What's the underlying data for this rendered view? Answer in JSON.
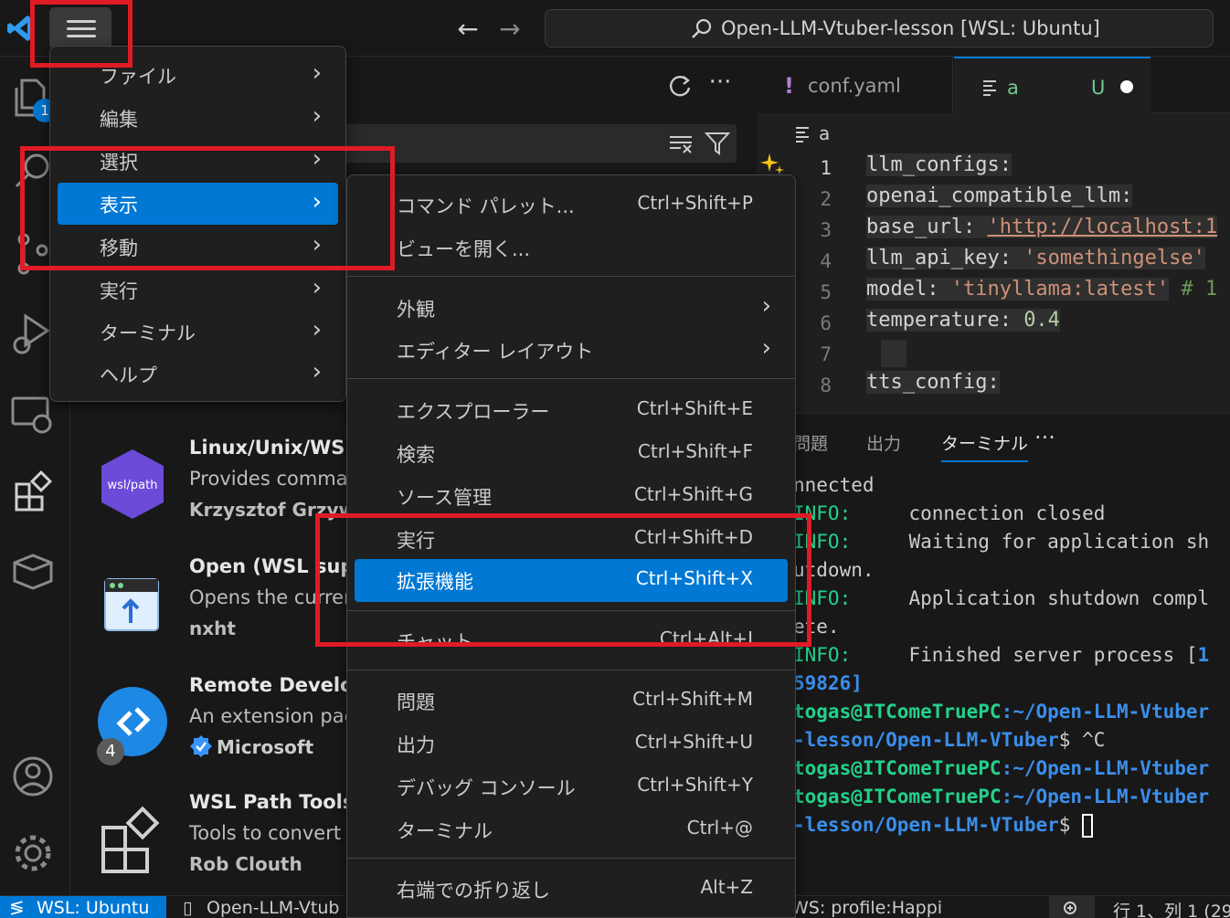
{
  "window": {
    "title": "Open-LLM-Vtuber-lesson [WSL: Ubuntu]"
  },
  "menubar": {
    "items": [
      {
        "label": "ファイル"
      },
      {
        "label": "編集"
      },
      {
        "label": "選択"
      },
      {
        "label": "表示"
      },
      {
        "label": "移動"
      },
      {
        "label": "実行"
      },
      {
        "label": "ターミナル"
      },
      {
        "label": "ヘルプ"
      }
    ],
    "selected": "表示"
  },
  "view_menu": {
    "items": [
      {
        "label": "コマンド パレット...",
        "shortcut": "Ctrl+Shift+P"
      },
      {
        "label": "ビューを開く...",
        "shortcut": ""
      },
      {
        "label": "外観",
        "shortcut": ""
      },
      {
        "label": "エディター レイアウト",
        "shortcut": ""
      },
      {
        "label": "エクスプローラー",
        "shortcut": "Ctrl+Shift+E"
      },
      {
        "label": "検索",
        "shortcut": "Ctrl+Shift+F"
      },
      {
        "label": "ソース管理",
        "shortcut": "Ctrl+Shift+G"
      },
      {
        "label": "実行",
        "shortcut": "Ctrl+Shift+D"
      },
      {
        "label": "拡張機能",
        "shortcut": "Ctrl+Shift+X"
      },
      {
        "label": "チャット",
        "shortcut": "Ctrl+Alt+I"
      },
      {
        "label": "問題",
        "shortcut": "Ctrl+Shift+M"
      },
      {
        "label": "出力",
        "shortcut": "Ctrl+Shift+U"
      },
      {
        "label": "デバッグ コンソール",
        "shortcut": "Ctrl+Shift+Y"
      },
      {
        "label": "ターミナル",
        "shortcut": "Ctrl+@"
      },
      {
        "label": "右端での折り返し",
        "shortcut": "Alt+Z"
      }
    ],
    "selected": "拡張機能"
  },
  "activity_bar": {
    "explorer_badge": "1",
    "accent": "#0078d4"
  },
  "extensions": [
    {
      "name": "Linux/Unix/WSL",
      "desc": "Provides comma",
      "publisher": "Krzysztof Grzywoc",
      "icon_label": "wsl/path"
    },
    {
      "name": "Open (WSL supp",
      "desc": "Opens the currer",
      "publisher": "nxht"
    },
    {
      "name": "Remote Develop",
      "desc": "An extension pac",
      "publisher": "Microsoft",
      "count_badge": "4"
    },
    {
      "name": "WSL Path Tools",
      "desc": "Tools to convert",
      "publisher": "Rob Clouth"
    }
  ],
  "editor": {
    "tabs": [
      {
        "label": "conf.yaml",
        "icon": "!"
      },
      {
        "label": "a",
        "status": "U"
      }
    ],
    "breadcrumb": "a",
    "line_numbers": [
      "1",
      "2",
      "3",
      "4",
      "5",
      "6",
      "7",
      "8"
    ],
    "lines": [
      {
        "key": "llm_configs:",
        "value": ""
      },
      {
        "key": "openai_compatible_llm:",
        "value": ""
      },
      {
        "key": "base_url: ",
        "value": "'http://localhost:1"
      },
      {
        "key": "llm_api_key: ",
        "value": "'somethingelse'"
      },
      {
        "key": "model: ",
        "value": "'tinyllama:latest'",
        "comment": " # 1"
      },
      {
        "key": "temperature: ",
        "value": "0.4"
      },
      {
        "key": "",
        "value": ""
      },
      {
        "key": "tts_config:",
        "value": ""
      }
    ]
  },
  "panel": {
    "tabs": [
      "問題",
      "出力",
      "ターミナル"
    ],
    "active_tab": "ターミナル",
    "terminal": {
      "l1": "nnected",
      "l2_tag": "INFO:",
      "l2_msg": "connection closed",
      "l3_tag": "INFO:",
      "l3_msg": "Waiting for application sh",
      "l4": "utdown.",
      "l5_tag": "INFO:",
      "l5_msg": "Application shutdown compl",
      "l6": "ete.",
      "l7_tag": "INFO:",
      "l7_msg": "Finished server process [",
      "l7_num": "1",
      "l8": "59826]",
      "p1_user": "togas@ITComeTruePC",
      "p1_path": ":~/Open-LLM-Vtuber",
      "p1b_path": "-lesson/Open-LLM-VTuber",
      "p1b_cmd": "$ ^C",
      "p2_user": "togas@ITComeTruePC",
      "p2_path": ":~/Open-LLM-Vtuber",
      "p3_user": "togas@ITComeTruePC",
      "p3_path": ":~/Open-LLM-Vtuber",
      "p3b_path": "-lesson/Open-LLM-VTuber",
      "p3b_cmd": "$ "
    }
  },
  "status_bar": {
    "remote": "WSL: Ubuntu",
    "project": "Open-LLM-Vtub",
    "profile": "WS: profile:Happi",
    "position": "行 1、列 1 (29"
  }
}
